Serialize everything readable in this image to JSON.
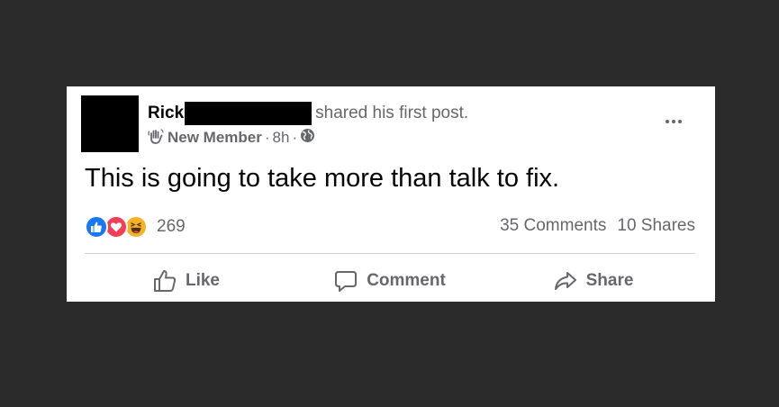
{
  "post": {
    "author_first_name": "Rick",
    "shared_text": "shared his first post.",
    "badge_label": "New Member",
    "timestamp": "8h",
    "separator": "·",
    "body_text": "This is going to take more than talk to fix.",
    "reaction_count": "269",
    "comments_count": "35 Comments",
    "shares_count": "10 Shares"
  },
  "actions": {
    "like_label": "Like",
    "comment_label": "Comment",
    "share_label": "Share"
  },
  "icons": {
    "badge": "waving-hand-icon",
    "privacy": "globe-icon",
    "more": "more-options-icon",
    "reactions": [
      "like-reaction-icon",
      "love-reaction-icon",
      "haha-reaction-icon"
    ]
  },
  "colors": {
    "background": "#2b2b2b",
    "card": "#ffffff",
    "primary_text": "#050505",
    "secondary_text": "#65676b",
    "like_blue": "#1877f2",
    "love_red": "#f33e58",
    "haha_yellow": "#f7b125"
  }
}
